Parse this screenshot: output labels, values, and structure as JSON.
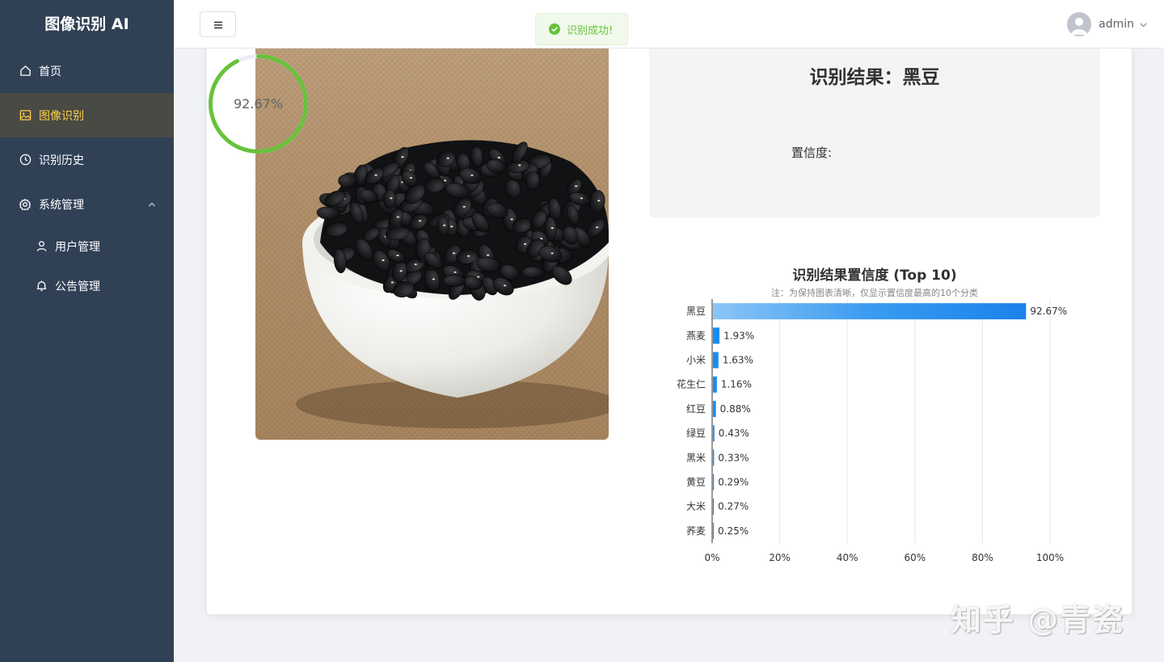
{
  "app": {
    "title": "图像识别 AI"
  },
  "sidebar": {
    "items": [
      {
        "label": "首页",
        "icon": "home-icon"
      },
      {
        "label": "图像识别",
        "icon": "image-icon",
        "active": true
      },
      {
        "label": "识别历史",
        "icon": "clock-icon"
      },
      {
        "label": "系统管理",
        "icon": "gear-icon",
        "expanded": true
      }
    ],
    "subitems": [
      {
        "label": "用户管理",
        "icon": "user-icon"
      },
      {
        "label": "公告管理",
        "icon": "bell-icon"
      }
    ]
  },
  "header": {
    "username": "admin"
  },
  "toast": {
    "message": "识别成功!"
  },
  "result": {
    "title": "识别结果：黑豆",
    "confidence_label": "置信度:",
    "confidence_text": "92.67%",
    "confidence_value": 92.67
  },
  "chart": {
    "title": "识别结果置信度 (Top 10)",
    "subtitle": "注：为保持图表清晰，仅显示置信度最高的10个分类"
  },
  "chart_data": {
    "type": "bar",
    "orientation": "horizontal",
    "categories": [
      "黑豆",
      "燕麦",
      "小米",
      "花生仁",
      "红豆",
      "绿豆",
      "黑米",
      "黄豆",
      "大米",
      "荞麦"
    ],
    "values": [
      92.67,
      1.93,
      1.63,
      1.16,
      0.88,
      0.43,
      0.33,
      0.29,
      0.27,
      0.25
    ],
    "value_labels": [
      "92.67%",
      "1.93%",
      "1.63%",
      "1.16%",
      "0.88%",
      "0.43%",
      "0.33%",
      "0.29%",
      "0.27%",
      "0.25%"
    ],
    "xlim": [
      0,
      100
    ],
    "x_ticks": [
      "0%",
      "20%",
      "40%",
      "60%",
      "80%",
      "100%"
    ],
    "grid": true,
    "bar_color": "#1a8cf0"
  },
  "colors": {
    "sidebar_bg": "#304156",
    "active_text": "#ffd04b",
    "gauge": "#67c23a",
    "success": "#67c23a"
  },
  "watermark": "知乎 @青瓷"
}
